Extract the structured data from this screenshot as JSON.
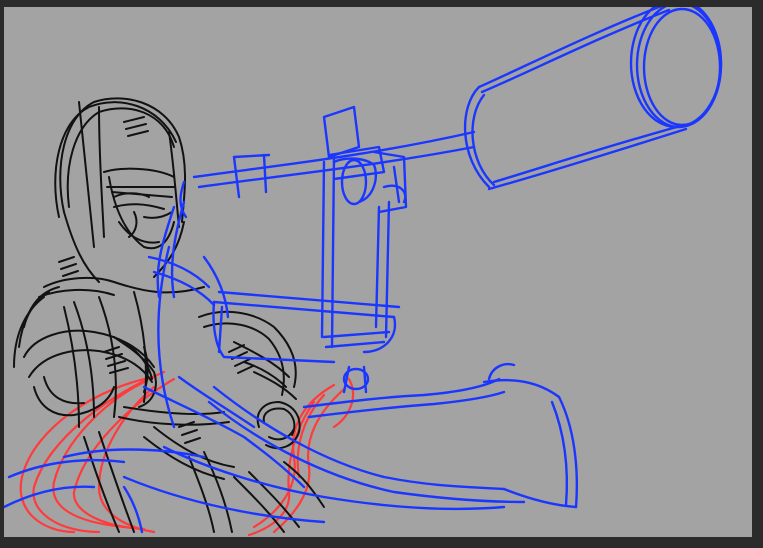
{
  "canvas": {
    "background": "#a3a3a3",
    "frame_color": "#2b2b2b"
  },
  "layers": [
    {
      "name": "figure-sketch",
      "color": "#111111"
    },
    {
      "name": "weapon-sketch",
      "color": "#1a35ff"
    },
    {
      "name": "effect-sketch",
      "color": "#ff3a3a"
    }
  ]
}
